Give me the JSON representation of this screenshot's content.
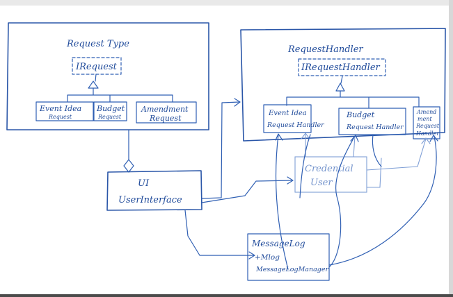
{
  "request_type": {
    "title": "Request Type",
    "interface": "IRequest",
    "classes": [
      {
        "line1": "Event Idea",
        "line2": "Request"
      },
      {
        "line1": "Budget",
        "line2": "Request"
      },
      {
        "line1": "Amendment",
        "line2": "Request"
      }
    ]
  },
  "request_handler": {
    "title": "RequestHandler",
    "interface": "IRequestHandler",
    "classes": [
      {
        "line1": "Event Idea",
        "line2": "Request Handler"
      },
      {
        "line1": "Budget",
        "line2": "Request Handler"
      },
      {
        "line1": "Amend",
        "line2": "ment",
        "line3": "Request",
        "line4": "Handler"
      }
    ]
  },
  "ui": {
    "line1": "UI",
    "line2": "UserInterface"
  },
  "credential": {
    "line1": "Credential",
    "line2": "User"
  },
  "message_log": {
    "line1": "MessageLog",
    "line2": "+Mlog",
    "line3": "MessageLogManager"
  },
  "colors": {
    "ink": "#2a56a8",
    "faint_ink": "#7f9fd6",
    "paper": "#ffffff"
  }
}
